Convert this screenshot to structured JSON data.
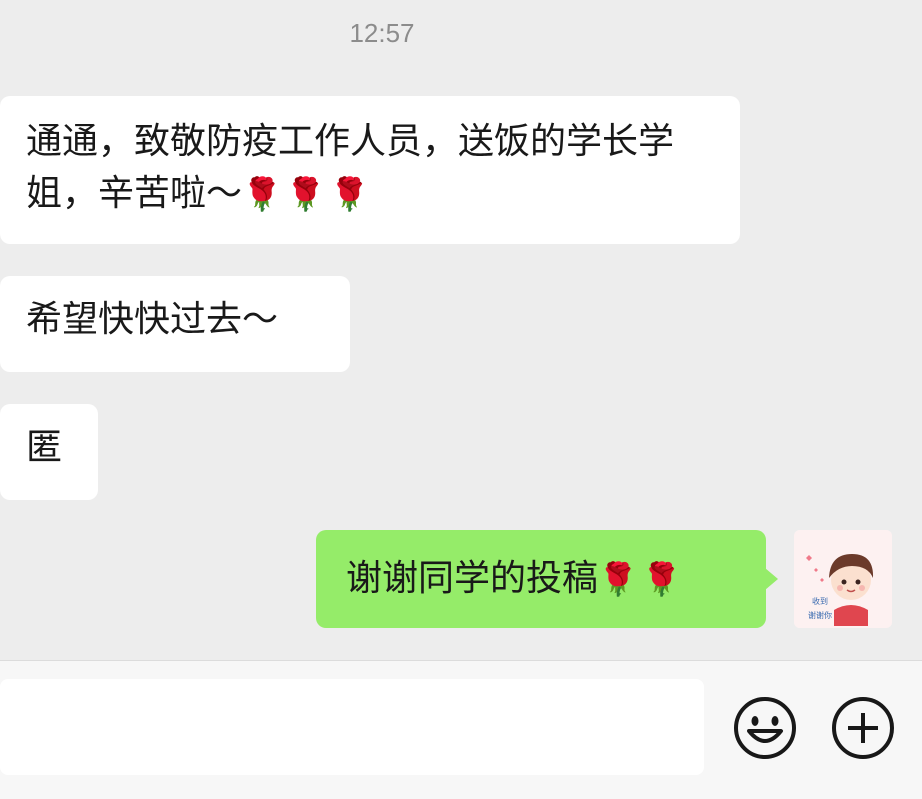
{
  "timestamp": "12:57",
  "messages": [
    {
      "text": "通通，致敬防疫工作人员，送饭的学长学姐，辛苦啦～",
      "emoji": "🌹🌹🌹"
    },
    {
      "text": "希望快快过去～"
    },
    {
      "text": "匿"
    }
  ],
  "my_message": {
    "text": "谢谢同学的投稿",
    "emoji": "🌹🌹"
  },
  "avatar": {
    "caption_line1": "收到",
    "caption_line2": "谢谢你"
  },
  "input": {
    "placeholder": ""
  },
  "icons": {
    "emoji": "smiley-icon",
    "more": "plus-circle-icon"
  },
  "colors": {
    "my_bubble": "#95ec69",
    "other_bubble": "#ffffff",
    "background": "#ededed"
  }
}
